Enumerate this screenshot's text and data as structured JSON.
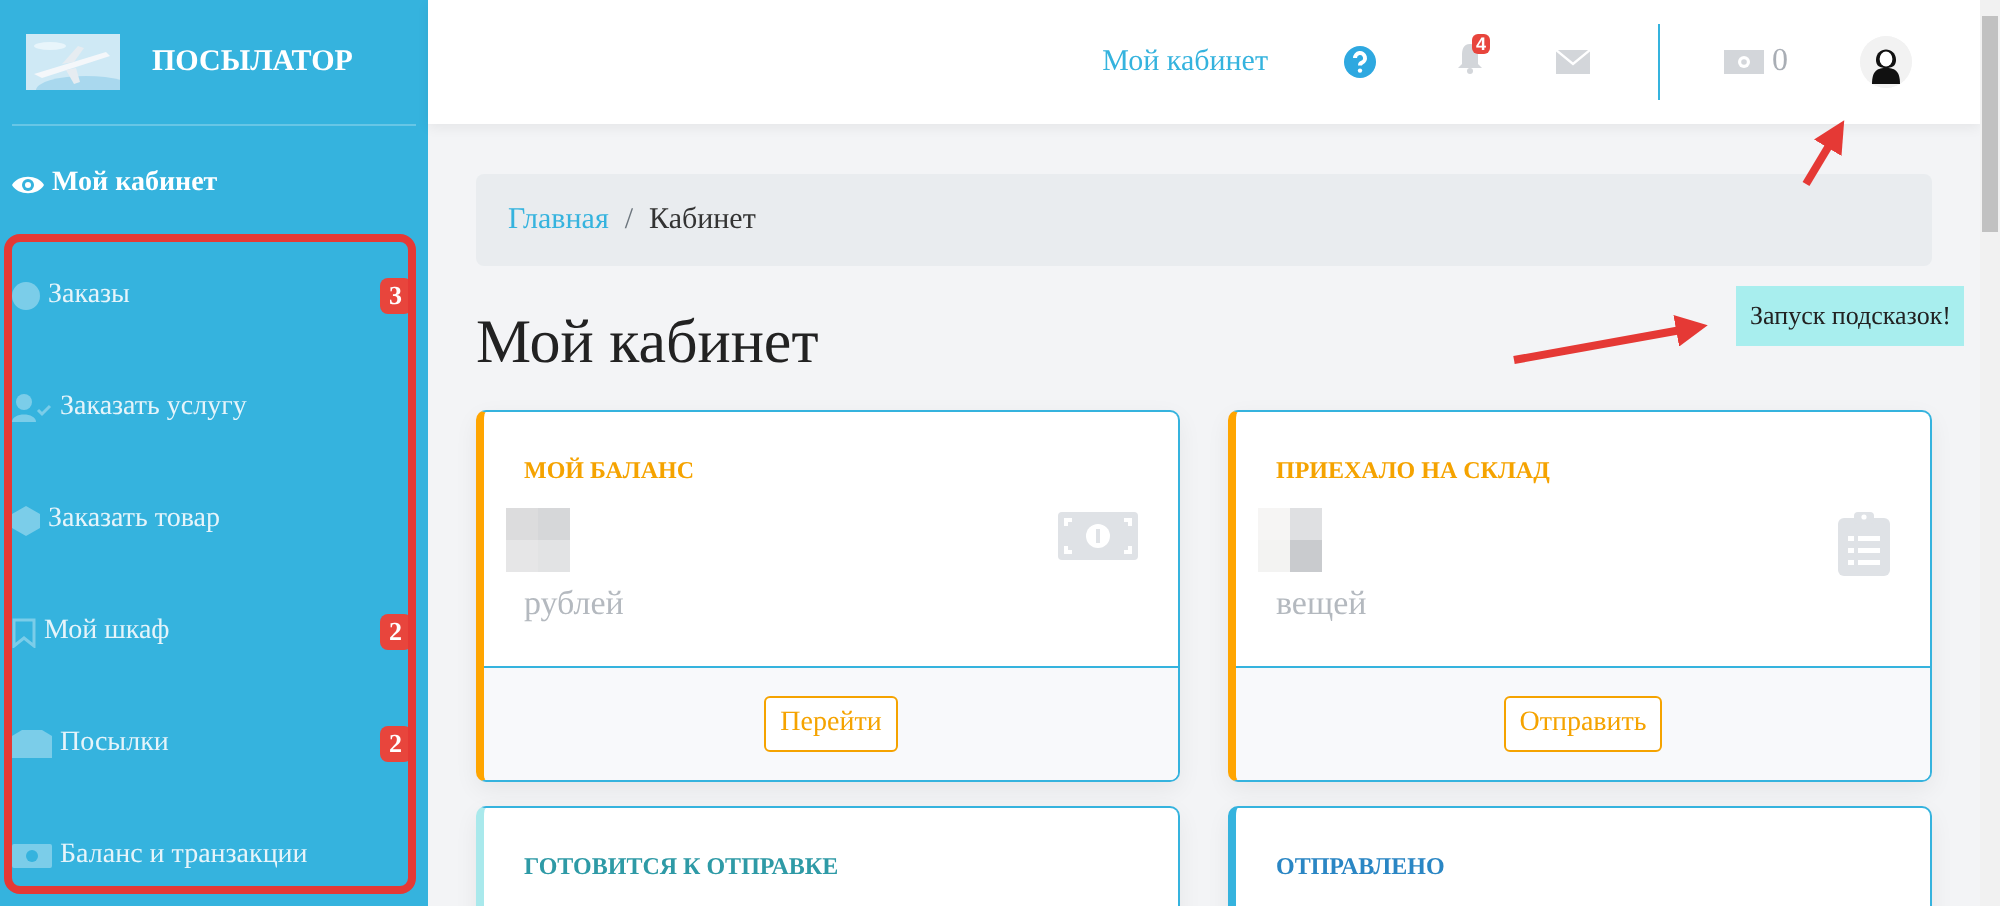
{
  "sidebar": {
    "brand": "ПОСЫЛАТОР",
    "items": [
      {
        "label": "Мой кабинет",
        "selected": true
      },
      {
        "label": "Заказы",
        "selected": false,
        "badge": "3"
      },
      {
        "label": "Заказать услугу",
        "selected": false
      },
      {
        "label": "Заказать товар",
        "selected": false
      },
      {
        "label": "Мой шкаф",
        "selected": false,
        "badge": "2"
      },
      {
        "label": "Посылки",
        "selected": false,
        "badge": "2"
      },
      {
        "label": "Баланс и транзакции",
        "selected": false
      }
    ]
  },
  "header": {
    "link": "Мой кабинет",
    "notification_count": "4",
    "balance": "0"
  },
  "breadcrumb": {
    "separator": "/",
    "items": [
      {
        "label": "Главная",
        "kind": "link"
      },
      {
        "label": "Кабинет",
        "kind": "current"
      }
    ]
  },
  "page_title": "Мой кабинет",
  "cards": [
    {
      "title": "МОЙ БАЛАНС",
      "unit": "рублей",
      "button": "Перейти",
      "color": "#ffa500"
    },
    {
      "title": "ПРИЕХАЛО НА СКЛАД",
      "unit": "вещей",
      "button": "Отправить",
      "color": "#ffa500"
    },
    {
      "title": "ГОТОВИТСЯ К ОТПРАВКЕ",
      "color": "#a9e9ec"
    },
    {
      "title": "ОТПРАВЛЕНО",
      "color": "#35b3de"
    }
  ],
  "hint_tooltip": "Запуск подсказок!"
}
